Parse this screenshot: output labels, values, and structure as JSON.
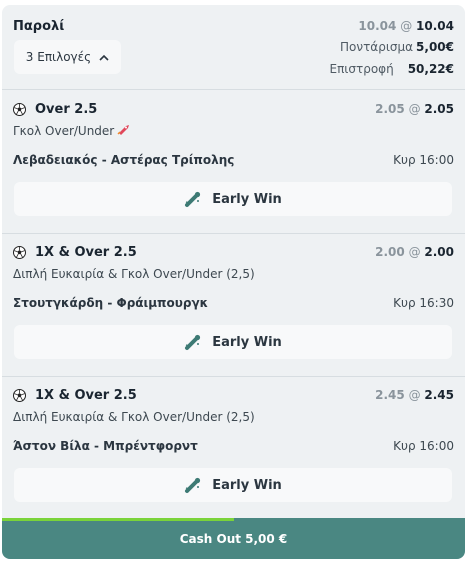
{
  "header": {
    "title": "Παρολί",
    "selections_label": "3 Επιλογές",
    "odds_old": "10.04",
    "odds_new": "10.04",
    "stake_label": "Ποντάρισμα",
    "stake_value": "5,00€",
    "return_label": "Επιστροφή",
    "return_value": "50,22€"
  },
  "odds_separator": "@",
  "selections": [
    {
      "market": "Over 2.5",
      "submarket": "Γκολ Over/Under",
      "odds_old": "2.05",
      "odds_new": "2.05",
      "match": "Λεβαδειακός - Αστέρας Τρίπολης",
      "time": "Κυρ 16:00",
      "early_win_label": "Early Win"
    },
    {
      "market": "1X & Over 2.5",
      "submarket": "Διπλή Ευκαιρία & Γκολ Over/Under (2,5)",
      "odds_old": "2.00",
      "odds_new": "2.00",
      "match": "Στουτγκάρδη - Φράιμπουργκ",
      "time": "Κυρ 16:30",
      "early_win_label": "Early Win"
    },
    {
      "market": "1X & Over 2.5",
      "submarket": "Διπλή Ευκαιρία & Γκολ Over/Under (2,5)",
      "odds_old": "2.45",
      "odds_new": "2.45",
      "match": "Άστον Βίλα - Μπρέντφορντ",
      "time": "Κυρ 16:00",
      "early_win_label": "Early Win"
    }
  ],
  "cashout": {
    "label": "Cash Out 5,00 €",
    "progress": 0.5
  },
  "colors": {
    "cashout_bg": "#4a8782",
    "progress": "#7ad33a",
    "card_bg": "#eef1f3"
  }
}
